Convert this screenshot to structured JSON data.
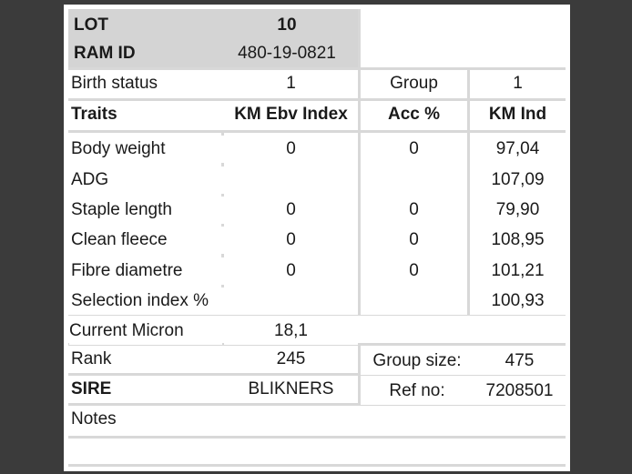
{
  "header": {
    "lot_label": "LOT",
    "lot_value": "10",
    "ram_id_label": "RAM ID",
    "ram_id_value": "480-19-0821"
  },
  "birth": {
    "label": "Birth status",
    "value": "1",
    "group_label": "Group",
    "group_value": "1"
  },
  "traits_table": {
    "columns": [
      "Traits",
      "KM Ebv Index",
      "Acc %",
      "KM Ind"
    ],
    "rows": [
      {
        "trait": "Body weight",
        "ebv": "0",
        "acc": "0",
        "ind": "97,04"
      },
      {
        "trait": "ADG",
        "ebv": "",
        "acc": "",
        "ind": "107,09"
      },
      {
        "trait": "Staple length",
        "ebv": "0",
        "acc": "0",
        "ind": "79,90"
      },
      {
        "trait": "Clean fleece",
        "ebv": "0",
        "acc": "0",
        "ind": "108,95"
      },
      {
        "trait": "Fibre diametre",
        "ebv": "0",
        "acc": "0",
        "ind": "101,21"
      },
      {
        "trait": "Selection index %",
        "ebv": "",
        "acc": "",
        "ind": "100,93"
      }
    ]
  },
  "micron": {
    "label": "Current Micron",
    "value": "18,1"
  },
  "rank": {
    "label": "Rank",
    "value": "245",
    "group_size_label": "Group size:",
    "group_size_value": "475"
  },
  "sire": {
    "label": "SIRE",
    "value": "BLIKNERS",
    "ref_label": "Ref no:",
    "ref_value": "7208501"
  },
  "notes": {
    "label": "Notes",
    "value": ""
  }
}
